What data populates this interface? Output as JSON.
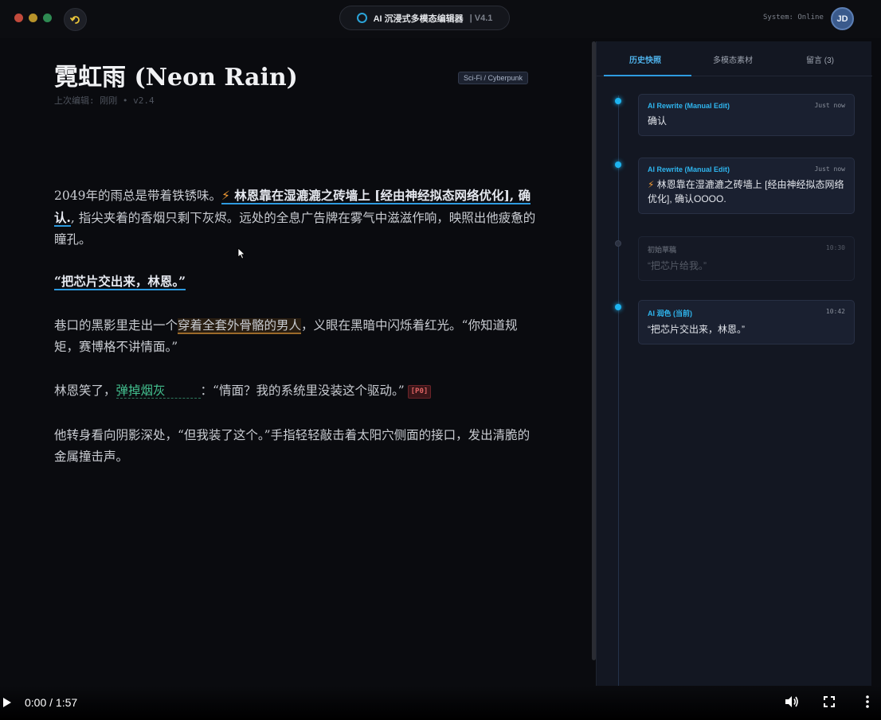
{
  "window": {
    "title": "AI 沉浸式多模态编辑器",
    "version": "| V4.1",
    "system_status": "System: Online",
    "user_initials": "JD"
  },
  "doc": {
    "title": "霓虹雨 (Neon Rain)",
    "genre_tag": "Sci-Fi / Cyberpunk",
    "meta": "上次编辑: 刚刚 • v2.4",
    "p1_a": "2049年的雨总是带着铁锈味。",
    "p1_bolt": "⚡",
    "p1_hl": " 林恩靠在湿漉漉之砖墙上 [经由神经拟态网络优化], 确认.",
    "p1_b": ", 指尖夹着的香烟只剩下灰烬。远处的全息广告牌在雾气中滋滋作响，映照出他疲惫的瞳孔。",
    "p2": "“把芯片交出来，林恩。”",
    "p3_a": "巷口的黑影里走出一个",
    "p3_hl": "穿着全套外骨骼的男人",
    "p3_b": "，义眼在黑暗中闪烁着红光。“你知道规矩，赛博格不讲情面。”",
    "p4_a": "林恩笑了，",
    "p4_hl": "弹掉烟灰",
    "p4_b": "：“情面？我的系统里没装这个驱动。”",
    "p4_tag": "[P0]",
    "p5": "他转身看向阴影深处，“但我装了这个。”手指轻轻敲击着太阳穴侧面的接口，发出清脆的金属撞击声。"
  },
  "panel": {
    "tabs": [
      {
        "label": "历史快照"
      },
      {
        "label": "多模态素材"
      },
      {
        "label": "留言 (3)"
      }
    ],
    "history": [
      {
        "type": "AI Rewrite (Manual Edit)",
        "time": "Just now",
        "text": "确认"
      },
      {
        "type": "AI Rewrite (Manual Edit)",
        "time": "Just now",
        "bolt": "⚡",
        "text": " 林恩靠在湿漉漉之砖墙上 [经由神经拟态网络优化], 确认OOOO."
      },
      {
        "type": "初始草稿",
        "time": "10:30",
        "text": "“把芯片给我。”"
      },
      {
        "type": "AI 润色 (当前)",
        "time": "10:42",
        "text": "“把芯片交出来，林恩。”"
      }
    ]
  },
  "video": {
    "time": "0:00 / 1:57"
  },
  "colors": {
    "accent": "#2e9be0",
    "background": "#0a0b0f",
    "panel": "#131722",
    "warning": "#e06464",
    "bolt": "#f09a34"
  }
}
